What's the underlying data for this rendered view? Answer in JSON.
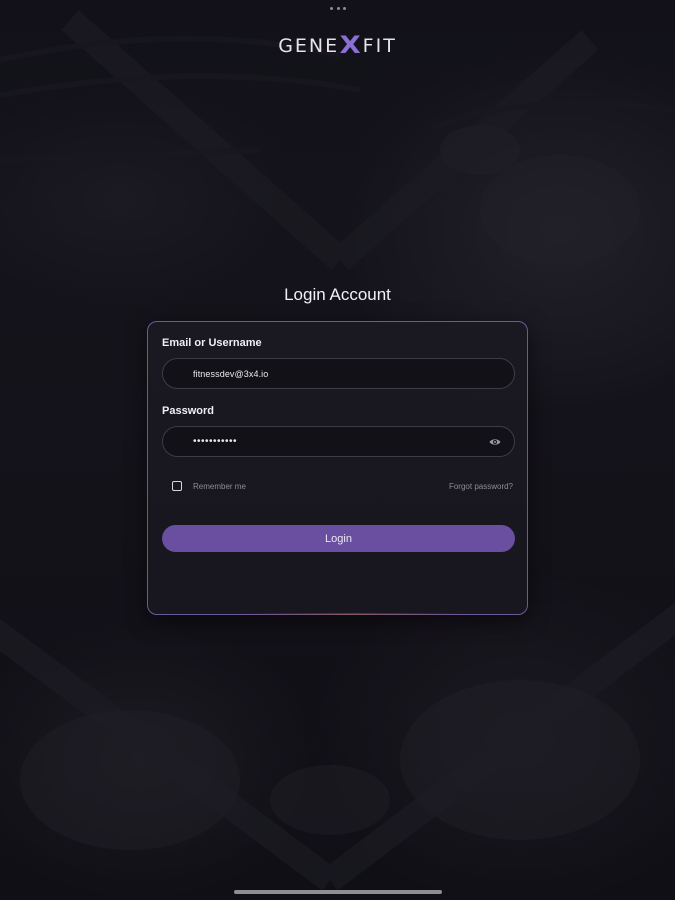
{
  "brand": {
    "logo_left": "GENE",
    "logo_mark": "X",
    "logo_right": "FIT",
    "accent_color": "#8c6fd2"
  },
  "page_title": "Login Account",
  "form": {
    "email_label": "Email or Username",
    "email_value": "fitnessdev@3x4.io",
    "password_label": "Password",
    "password_value": "•••••••••••",
    "password_toggle_icon": "eye-icon",
    "remember_label": "Remember me",
    "remember_checked": false,
    "forgot_label": "Forgot password?",
    "login_label": "Login",
    "button_color": "#6a4fa0"
  },
  "system": {
    "top_indicator_icon": "more-dots-icon",
    "home_indicator": "home-indicator"
  }
}
